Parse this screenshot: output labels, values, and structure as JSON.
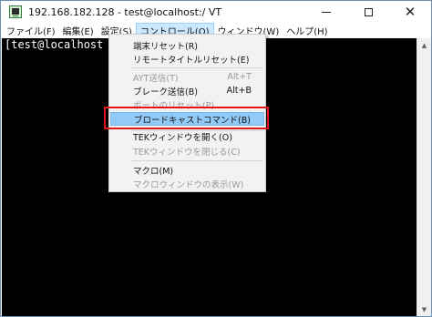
{
  "window": {
    "title": "192.168.182.128 - test@localhost:/ VT",
    "icon": "terminal-app-icon",
    "controls": {
      "minimize": "minimize-icon",
      "maximize": "maximize-icon",
      "close": "✕"
    }
  },
  "menubar": {
    "items": [
      {
        "label": "ファイル(F)"
      },
      {
        "label": "編集(E)"
      },
      {
        "label": "設定(S)"
      },
      {
        "label": "コントロール(O)",
        "active": true
      },
      {
        "label": "ウィンドウ(W)"
      },
      {
        "label": "ヘルプ(H)"
      }
    ]
  },
  "terminal": {
    "prompt": "[test@localhost /]$",
    "background": "#000000",
    "foreground": "#ffffff"
  },
  "dropdown": {
    "items": [
      {
        "label": "端末リセット(R)",
        "shortcut": "",
        "disabled": false
      },
      {
        "label": "リモートタイトルリセット(E)",
        "shortcut": "",
        "disabled": false
      },
      {
        "label": "AYT送信(T)",
        "shortcut": "Alt+T",
        "disabled": true
      },
      {
        "label": "ブレーク送信(B)",
        "shortcut": "Alt+B",
        "disabled": false
      },
      {
        "label": "ポートのリセット(P)",
        "shortcut": "",
        "disabled": true
      },
      {
        "label": "ブロードキャストコマンド(B)",
        "shortcut": "",
        "disabled": false,
        "highlighted": true
      },
      {
        "label": "TEKウィンドウを開く(O)",
        "shortcut": "",
        "disabled": false
      },
      {
        "label": "TEKウィンドウを閉じる(C)",
        "shortcut": "",
        "disabled": true
      },
      {
        "label": "マクロ(M)",
        "shortcut": "",
        "disabled": false
      },
      {
        "label": "マクロウィンドウの表示(W)",
        "shortcut": "",
        "disabled": true
      }
    ],
    "highlight_color": "#91c9f7",
    "annotation_color": "#e0161b"
  }
}
